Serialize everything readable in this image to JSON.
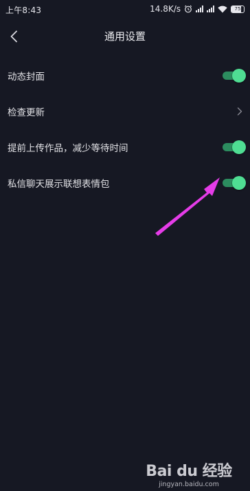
{
  "status_bar": {
    "time": "上午8:43",
    "network_speed": "14.8K/s",
    "battery_level": "75",
    "icons": [
      "alarm-icon",
      "signal-icon",
      "signal-icon",
      "wifi-icon",
      "battery-icon"
    ]
  },
  "nav": {
    "back_icon": "chevron-left-icon",
    "title": "通用设置"
  },
  "settings": [
    {
      "label": "动态封面",
      "control": "toggle",
      "on": true
    },
    {
      "label": "检查更新",
      "control": "chevron"
    },
    {
      "label": "提前上传作品，减少等待时间",
      "control": "toggle",
      "on": true
    },
    {
      "label": "私信聊天展示联想表情包",
      "control": "toggle",
      "on": true
    }
  ],
  "colors": {
    "background": "#161823",
    "toggle_track": "#2c8c5f",
    "toggle_knob": "#4fdd93",
    "annotation_arrow": "#e53ce8"
  },
  "watermark": {
    "brand": "Bai du 经验",
    "url": "jingyan.baidu.com"
  }
}
